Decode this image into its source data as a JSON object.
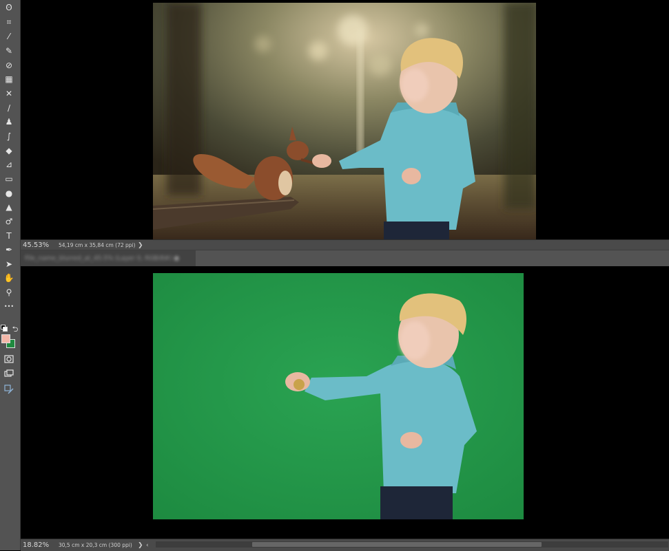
{
  "toolbar": {
    "tools": [
      {
        "name": "lasso-icon",
        "glyph": "ʘ"
      },
      {
        "name": "crop-icon",
        "glyph": "⌗"
      },
      {
        "name": "eyedropper-icon",
        "glyph": "⁄"
      },
      {
        "name": "spot-healing-icon",
        "glyph": "✎"
      },
      {
        "name": "bandage-icon",
        "glyph": "⊘"
      },
      {
        "name": "frame-icon",
        "glyph": "▦"
      },
      {
        "name": "content-aware-move-icon",
        "glyph": "✕"
      },
      {
        "name": "brush-icon",
        "glyph": "∕"
      },
      {
        "name": "clone-stamp-icon",
        "glyph": "♟"
      },
      {
        "name": "history-brush-icon",
        "glyph": "∫"
      },
      {
        "name": "eraser-icon",
        "glyph": "◆"
      },
      {
        "name": "paint-bucket-icon",
        "glyph": "⊿"
      },
      {
        "name": "gradient-icon",
        "glyph": "▭"
      },
      {
        "name": "blur-drop-icon",
        "glyph": "●"
      },
      {
        "name": "sharpen-icon",
        "glyph": "▲"
      },
      {
        "name": "dodge-icon",
        "glyph": "♂"
      },
      {
        "name": "type-icon",
        "glyph": "T"
      },
      {
        "name": "pen-icon",
        "glyph": "✒"
      },
      {
        "name": "path-selection-icon",
        "glyph": "➤"
      },
      {
        "name": "hand-icon",
        "glyph": "✋"
      },
      {
        "name": "zoom-icon",
        "glyph": "⚲"
      },
      {
        "name": "more-tools-icon",
        "glyph": "•••"
      }
    ],
    "foreground_color": "#f2b6a8",
    "background_color": "#1f8a3f"
  },
  "doc_top": {
    "zoom": "45.53%",
    "dims": "54,19 cm x 35,84 cm (72 ppi)",
    "chevron": "❯"
  },
  "tab_bar": {
    "tab_label": "File_name_blurred_at_45.5% (Layer 0, RGB/8#)  ●"
  },
  "doc_bottom": {
    "zoom": "18.82%",
    "dims": "30,5 cm x 20,3 cm (300 ppi)",
    "chevron": "❯",
    "scroll_left": "‹"
  },
  "colors": {
    "chroma_green": "#229a48",
    "panel": "#535353"
  }
}
